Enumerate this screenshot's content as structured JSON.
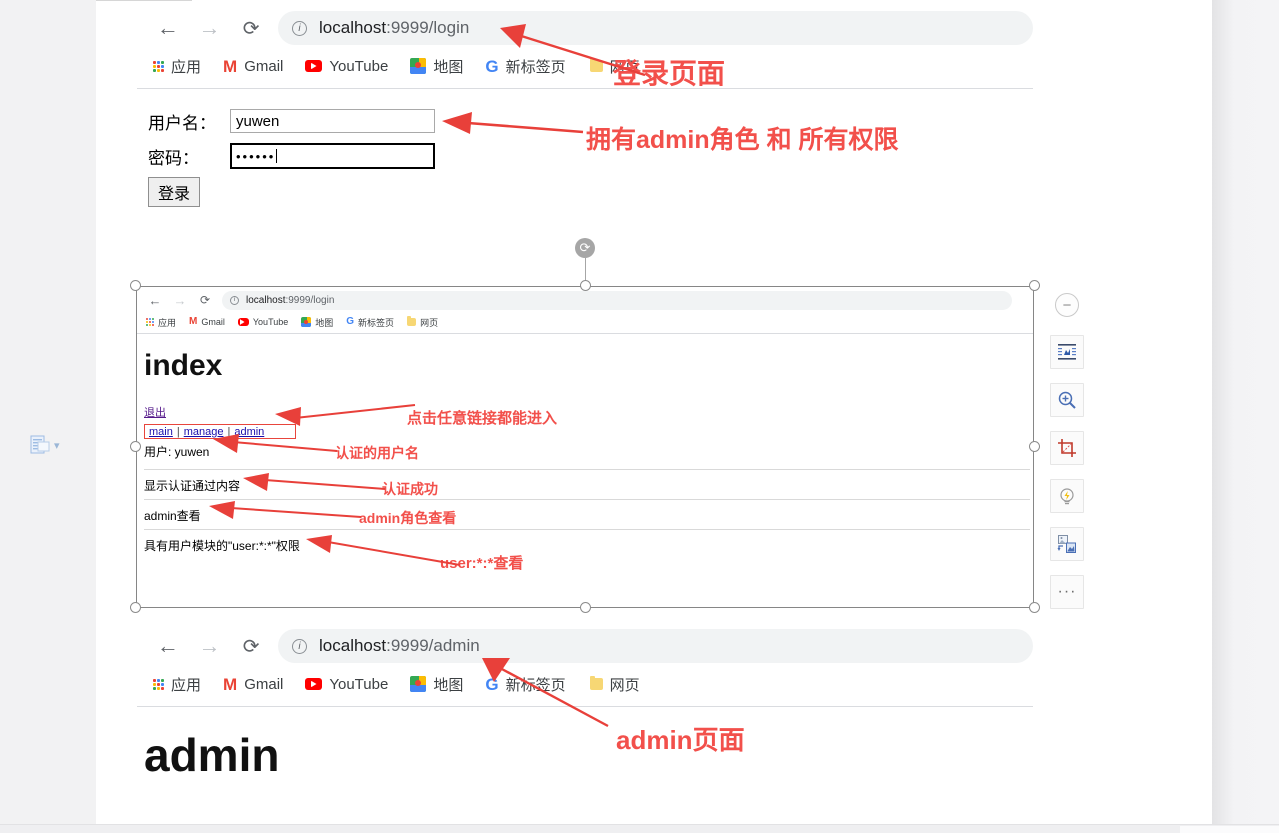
{
  "document": {
    "page_background": "#ffffff",
    "annotation_color": "#f2504b"
  },
  "top_browser": {
    "nav": {
      "back_label": "←",
      "forward_label": "→",
      "reload_label": "⟳"
    },
    "omnibox": {
      "info_icon": "info-icon",
      "url_host": "localhost",
      "url_rest": ":9999/login",
      "full_url": "localhost:9999/login"
    },
    "bookmarks": [
      {
        "icon": "apps-grid-icon",
        "label": "应用"
      },
      {
        "icon": "gmail-icon",
        "label": "Gmail"
      },
      {
        "icon": "youtube-icon",
        "label": "YouTube"
      },
      {
        "icon": "maps-icon",
        "label": "地图"
      },
      {
        "icon": "google-icon",
        "label": "新标签页"
      },
      {
        "icon": "folder-icon",
        "label": "网页"
      }
    ]
  },
  "login_form": {
    "username_label": "用户名：",
    "username_value": "yuwen",
    "password_label": "密码：",
    "password_value": "••••••",
    "submit_label": "登录"
  },
  "annotations_top": [
    {
      "name": "login-page-note",
      "text": "登录页面"
    },
    {
      "name": "admin-role-note",
      "text": "拥有admin角色 和 所有权限"
    }
  ],
  "embedded_screenshot": {
    "selected": true,
    "browser": {
      "nav": {
        "back_label": "←",
        "forward_label": "→",
        "reload_label": "⟳"
      },
      "omnibox": {
        "info_icon": "info-icon",
        "url_host": "localhost",
        "url_rest": ":9999/login",
        "full_url": "localhost:9999/login"
      },
      "bookmarks": [
        {
          "icon": "apps-grid-icon",
          "label": "应用"
        },
        {
          "icon": "gmail-icon",
          "label": "Gmail"
        },
        {
          "icon": "youtube-icon",
          "label": "YouTube"
        },
        {
          "icon": "maps-icon",
          "label": "地图"
        },
        {
          "icon": "google-icon",
          "label": "新标签页"
        },
        {
          "icon": "folder-icon",
          "label": "网页"
        }
      ]
    },
    "page": {
      "heading": "index",
      "logout_link": "退出",
      "nav_links": [
        "main",
        "manage",
        "admin"
      ],
      "nav_separator": "|",
      "user_line": "用户: yuwen",
      "rows": [
        "显示认证通过内容",
        "admin查看",
        "具有用户模块的\"user:*:*\"权限"
      ]
    },
    "annotations": [
      {
        "name": "click-any-link-note",
        "text": "点击任意链接都能进入"
      },
      {
        "name": "authenticated-username-note",
        "text": "认证的用户名"
      },
      {
        "name": "auth-success-note",
        "text": "认证成功"
      },
      {
        "name": "admin-role-view-note",
        "text": "admin角色查看"
      },
      {
        "name": "user-perm-note",
        "text": "user:*:*查看"
      }
    ]
  },
  "bottom_browser": {
    "nav": {
      "back_label": "←",
      "forward_label": "→",
      "reload_label": "⟳"
    },
    "omnibox": {
      "info_icon": "info-icon",
      "url_host": "localhost",
      "url_rest": ":9999/admin",
      "full_url": "localhost:9999/admin"
    },
    "bookmarks": [
      {
        "icon": "apps-grid-icon",
        "label": "应用"
      },
      {
        "icon": "gmail-icon",
        "label": "Gmail"
      },
      {
        "icon": "youtube-icon",
        "label": "YouTube"
      },
      {
        "icon": "maps-icon",
        "label": "地图"
      },
      {
        "icon": "google-icon",
        "label": "新标签页"
      },
      {
        "icon": "folder-icon",
        "label": "网页"
      }
    ],
    "page_heading": "admin",
    "annotation": "admin页面"
  },
  "image_toolbar": {
    "items": [
      {
        "name": "collapse-toolbar-button",
        "icon": "minus-circle-icon",
        "label": "−"
      },
      {
        "name": "layout-options-button",
        "icon": "text-wrap-icon",
        "label": ""
      },
      {
        "name": "zoom-button",
        "icon": "magnifier-plus-icon",
        "label": ""
      },
      {
        "name": "crop-button",
        "icon": "crop-icon",
        "label": ""
      },
      {
        "name": "design-ideas-button",
        "icon": "lightbulb-icon",
        "label": ""
      },
      {
        "name": "replace-image-button",
        "icon": "replace-image-icon",
        "label": ""
      },
      {
        "name": "more-options-button",
        "icon": "ellipsis-icon",
        "label": "···"
      }
    ]
  },
  "paste_options": {
    "name": "paste-options-button",
    "icon": "paste-clipboard-icon",
    "chevron": "▾"
  }
}
